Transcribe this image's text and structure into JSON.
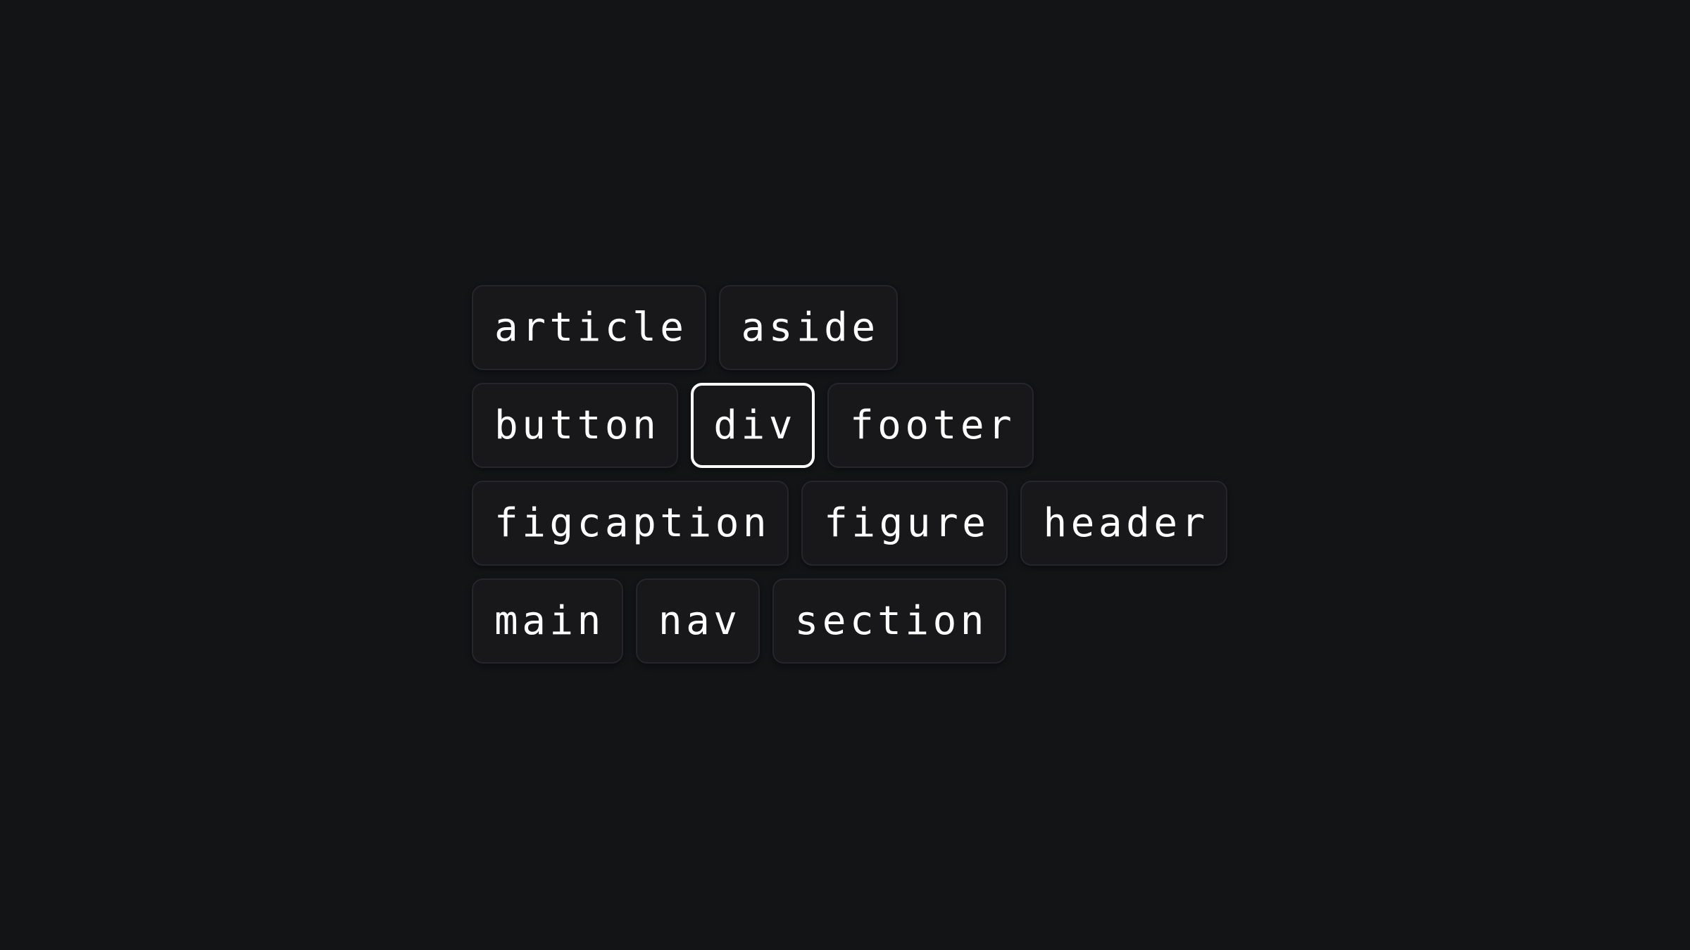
{
  "tag_cloud": {
    "selected": "div",
    "rows": [
      {
        "tags": [
          {
            "label": "article"
          },
          {
            "label": "aside"
          }
        ]
      },
      {
        "tags": [
          {
            "label": "button"
          },
          {
            "label": "div",
            "selected": true
          },
          {
            "label": "footer"
          }
        ]
      },
      {
        "tags": [
          {
            "label": "figcaption"
          },
          {
            "label": "figure"
          },
          {
            "label": "header"
          }
        ]
      },
      {
        "tags": [
          {
            "label": "main"
          },
          {
            "label": "nav"
          },
          {
            "label": "section"
          }
        ]
      }
    ]
  },
  "colors": {
    "background": "#131416",
    "chip_background": "#18181b",
    "chip_border": "#26262a",
    "selected_border": "#ffffff",
    "text": "#ffffff"
  }
}
